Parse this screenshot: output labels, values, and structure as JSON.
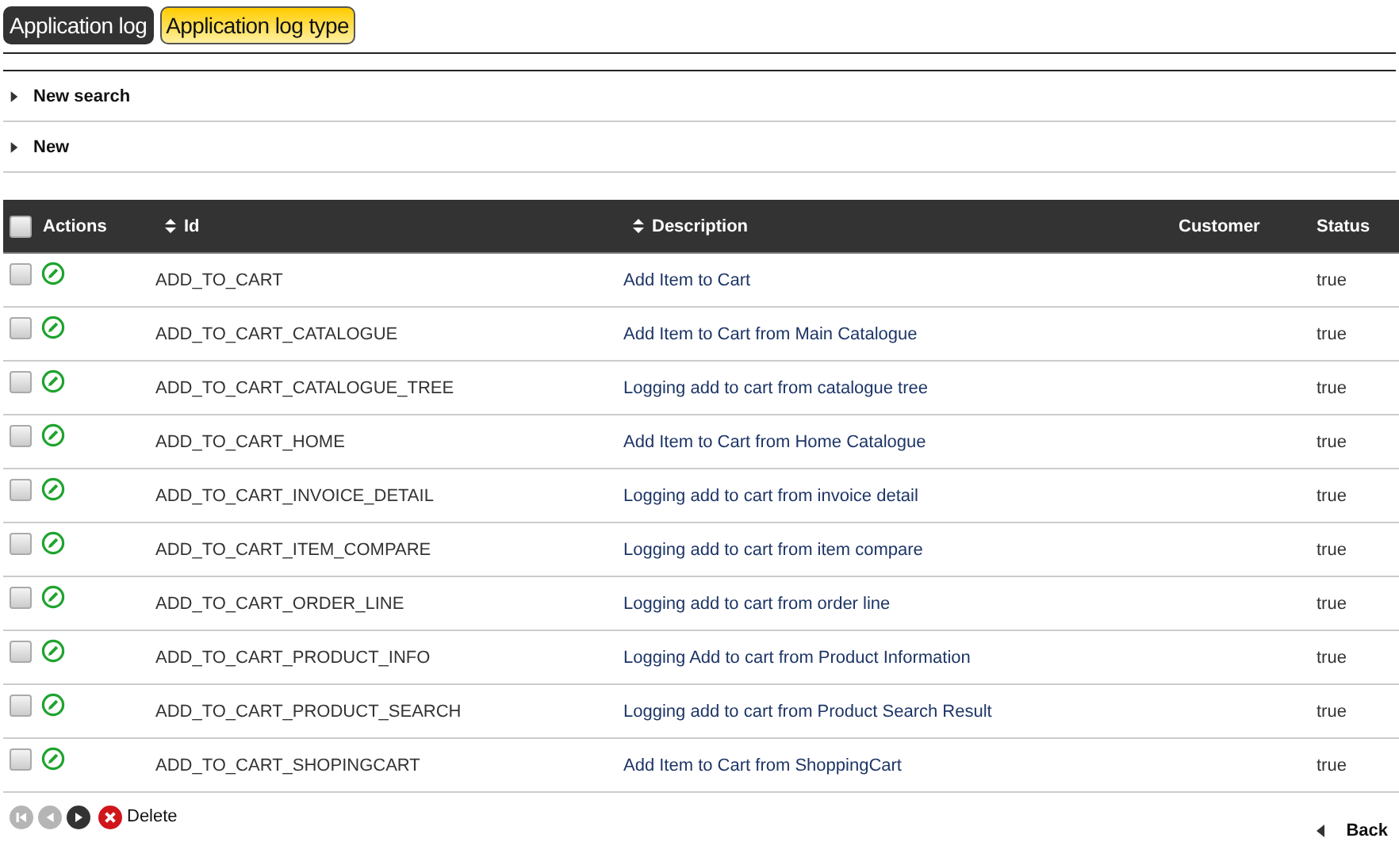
{
  "tabs": [
    {
      "label": "Application log",
      "selected": false
    },
    {
      "label": "Application log type",
      "selected": true
    }
  ],
  "sections": [
    {
      "label": "New search",
      "expanded": false
    },
    {
      "label": "New",
      "expanded": false
    }
  ],
  "table": {
    "select_all": {
      "checked": false
    },
    "columns": [
      {
        "label": "Actions",
        "kind": "plain"
      },
      {
        "label": "Id",
        "kind": "sortable"
      },
      {
        "label": "Description",
        "kind": "sortable"
      },
      {
        "label": "Customer",
        "kind": "plain"
      },
      {
        "label": "Status",
        "kind": "plain"
      }
    ],
    "rows": [
      {
        "checked": false,
        "id": "ADD_TO_CART",
        "description": "Add Item to Cart",
        "status": "true"
      },
      {
        "checked": false,
        "id": "ADD_TO_CART_CATALOGUE",
        "description": "Add Item to Cart from Main Catalogue",
        "status": "true"
      },
      {
        "checked": false,
        "id": "ADD_TO_CART_CATALOGUE_TREE",
        "description": "Logging add to cart from catalogue tree",
        "status": "true"
      },
      {
        "checked": false,
        "id": "ADD_TO_CART_HOME",
        "description": "Add Item to Cart from Home Catalogue",
        "status": "true"
      },
      {
        "checked": false,
        "id": "ADD_TO_CART_INVOICE_DETAIL",
        "description": "Logging add to cart from invoice detail",
        "status": "true"
      },
      {
        "checked": false,
        "id": "ADD_TO_CART_ITEM_COMPARE",
        "description": "Logging add to cart from item compare",
        "status": "true"
      },
      {
        "checked": false,
        "id": "ADD_TO_CART_ORDER_LINE",
        "description": "Logging add to cart from order line",
        "status": "true"
      },
      {
        "checked": false,
        "id": "ADD_TO_CART_PRODUCT_INFO",
        "description": "Logging Add to cart from Product Information",
        "status": "true"
      },
      {
        "checked": false,
        "id": "ADD_TO_CART_PRODUCT_SEARCH",
        "description": "Logging add to cart from Product Search Result",
        "status": "true"
      },
      {
        "checked": false,
        "id": "ADD_TO_CART_SHOPINGCART",
        "description": "Add Item to Cart from ShoppingCart",
        "status": "true"
      }
    ]
  },
  "pager": [
    {
      "kind": "first",
      "disabled": true
    },
    {
      "kind": "prev",
      "disabled": true
    },
    {
      "kind": "next",
      "disabled": false
    }
  ],
  "delete_label": "Delete",
  "back_label": "Back"
}
